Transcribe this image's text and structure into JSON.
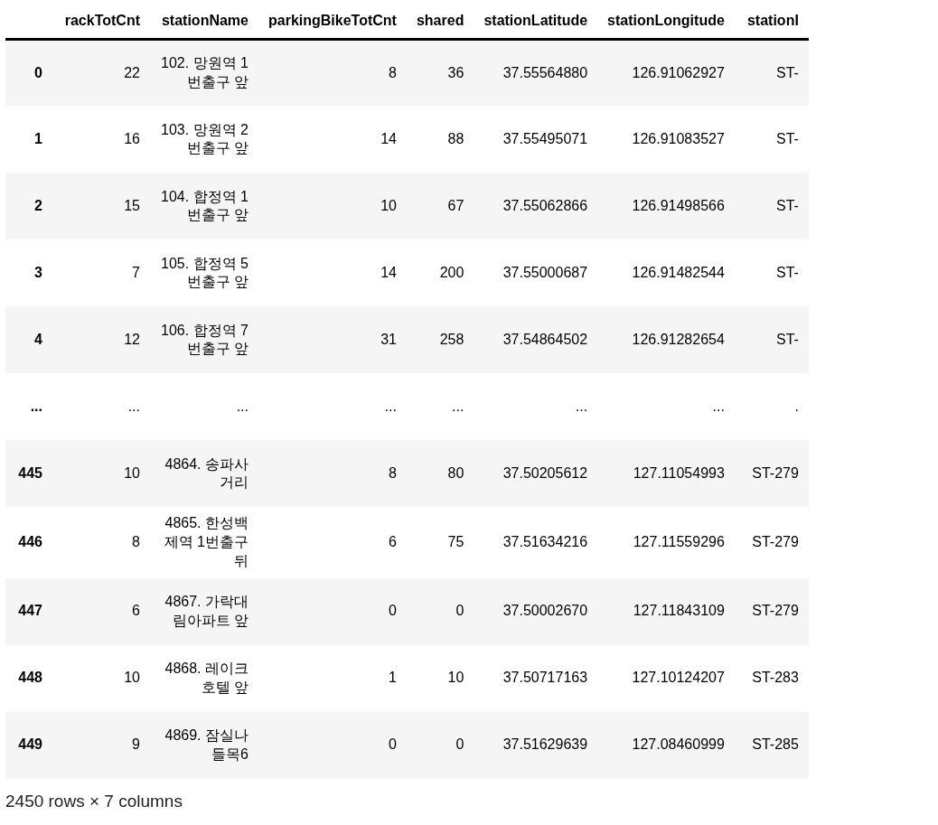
{
  "table": {
    "columns": [
      "rackTotCnt",
      "stationName",
      "parkingBikeTotCnt",
      "shared",
      "stationLatitude",
      "stationLongitude",
      "stationI"
    ],
    "rows": [
      {
        "index": "0",
        "cells": [
          "22",
          "102. 망원역 1번출구 앞",
          "8",
          "36",
          "37.55564880",
          "126.91062927",
          "ST-"
        ]
      },
      {
        "index": "1",
        "cells": [
          "16",
          "103. 망원역 2번출구 앞",
          "14",
          "88",
          "37.55495071",
          "126.91083527",
          "ST-"
        ]
      },
      {
        "index": "2",
        "cells": [
          "15",
          "104. 합정역 1번출구 앞",
          "10",
          "67",
          "37.55062866",
          "126.91498566",
          "ST-"
        ]
      },
      {
        "index": "3",
        "cells": [
          "7",
          "105. 합정역 5번출구 앞",
          "14",
          "200",
          "37.55000687",
          "126.91482544",
          "ST-"
        ]
      },
      {
        "index": "4",
        "cells": [
          "12",
          "106. 합정역 7번출구 앞",
          "31",
          "258",
          "37.54864502",
          "126.91282654",
          "ST-"
        ]
      },
      {
        "index": "...",
        "cells": [
          "...",
          "...",
          "...",
          "...",
          "...",
          "...",
          "."
        ]
      },
      {
        "index": "445",
        "cells": [
          "10",
          "4864. 송파사거리",
          "8",
          "80",
          "37.50205612",
          "127.11054993",
          "ST-279"
        ]
      },
      {
        "index": "446",
        "cells": [
          "8",
          "4865. 한성백제역 1번출구 뒤",
          "6",
          "75",
          "37.51634216",
          "127.11559296",
          "ST-279"
        ]
      },
      {
        "index": "447",
        "cells": [
          "6",
          "4867. 가락대림아파트 앞",
          "0",
          "0",
          "37.50002670",
          "127.11843109",
          "ST-279"
        ]
      },
      {
        "index": "448",
        "cells": [
          "10",
          "4868. 레이크호텔 앞",
          "1",
          "10",
          "37.50717163",
          "127.10124207",
          "ST-283"
        ]
      },
      {
        "index": "449",
        "cells": [
          "9",
          "4869. 잠실나들목6",
          "0",
          "0",
          "37.51629639",
          "127.08460999",
          "ST-285"
        ]
      }
    ]
  },
  "footer": "2450 rows × 7 columns"
}
